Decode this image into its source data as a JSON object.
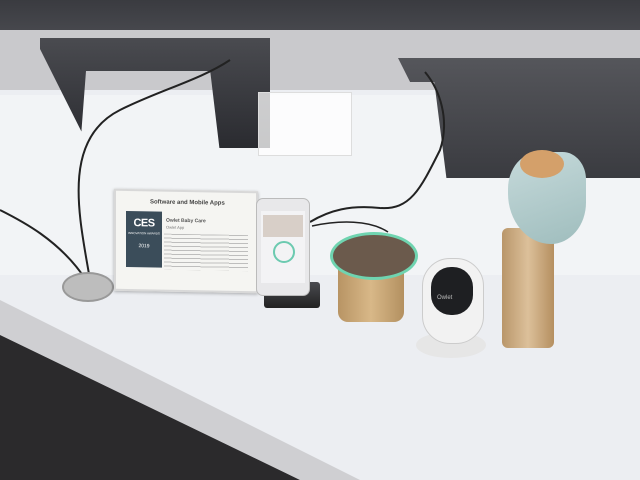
{
  "scene": {
    "description_labels": {
      "card_heading": "Software and Mobile Apps",
      "card_product": "Owlet Baby Care",
      "card_sub": "Owlet App",
      "award_ces": "CES",
      "award_small": "INNOVATION AWARDS",
      "award_year": "2019",
      "camera_logo": "Owlet"
    }
  },
  "colors": {
    "accent_green": "#6fd4b0",
    "wood": "#c9a878",
    "counter": "#f2f3f5"
  }
}
